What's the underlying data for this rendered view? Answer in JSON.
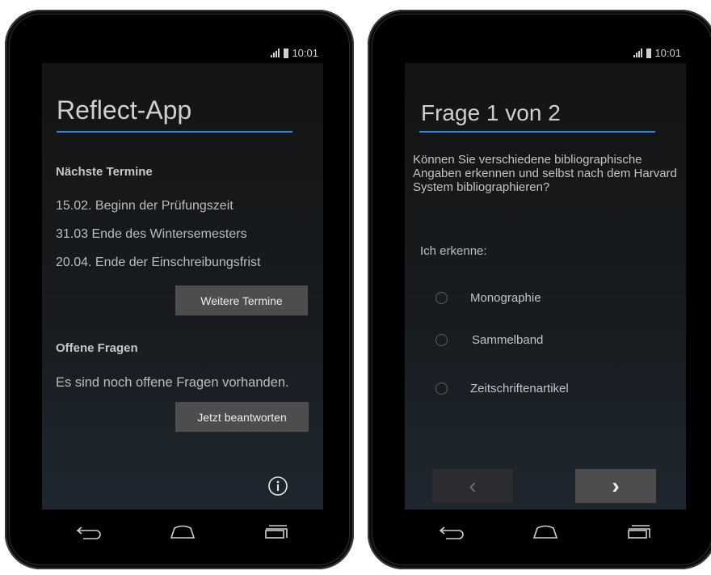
{
  "status": {
    "time": "10:01"
  },
  "screen1": {
    "title": "Reflect-App",
    "upcoming_heading": "Nächste Termine",
    "events": [
      "15.02.  Beginn der Prüfungszeit",
      "31.03  Ende des Wintersemesters",
      "20.04.  Ende der Einschreibungsfrist"
    ],
    "more_events_button": "Weitere Termine",
    "open_questions_heading": "Offene Fragen",
    "open_questions_text": "Es sind noch offene Fragen vorhanden.",
    "answer_now_button": "Jetzt beantworten"
  },
  "screen2": {
    "title": "Frage 1 von 2",
    "question": "Können Sie verschiedene bibliographische Angaben erkennen und selbst nach dem Harvard System bibliographieren?",
    "prompt": "Ich erkenne:",
    "options": [
      "Monographie",
      "Sammelband",
      "Zeitschriftenartikel"
    ],
    "prev_symbol": "‹",
    "next_symbol": "›"
  },
  "colors": {
    "accent": "#2f86d6",
    "button": "#4d4d4d",
    "nav_disabled": "#2a2c2f"
  }
}
